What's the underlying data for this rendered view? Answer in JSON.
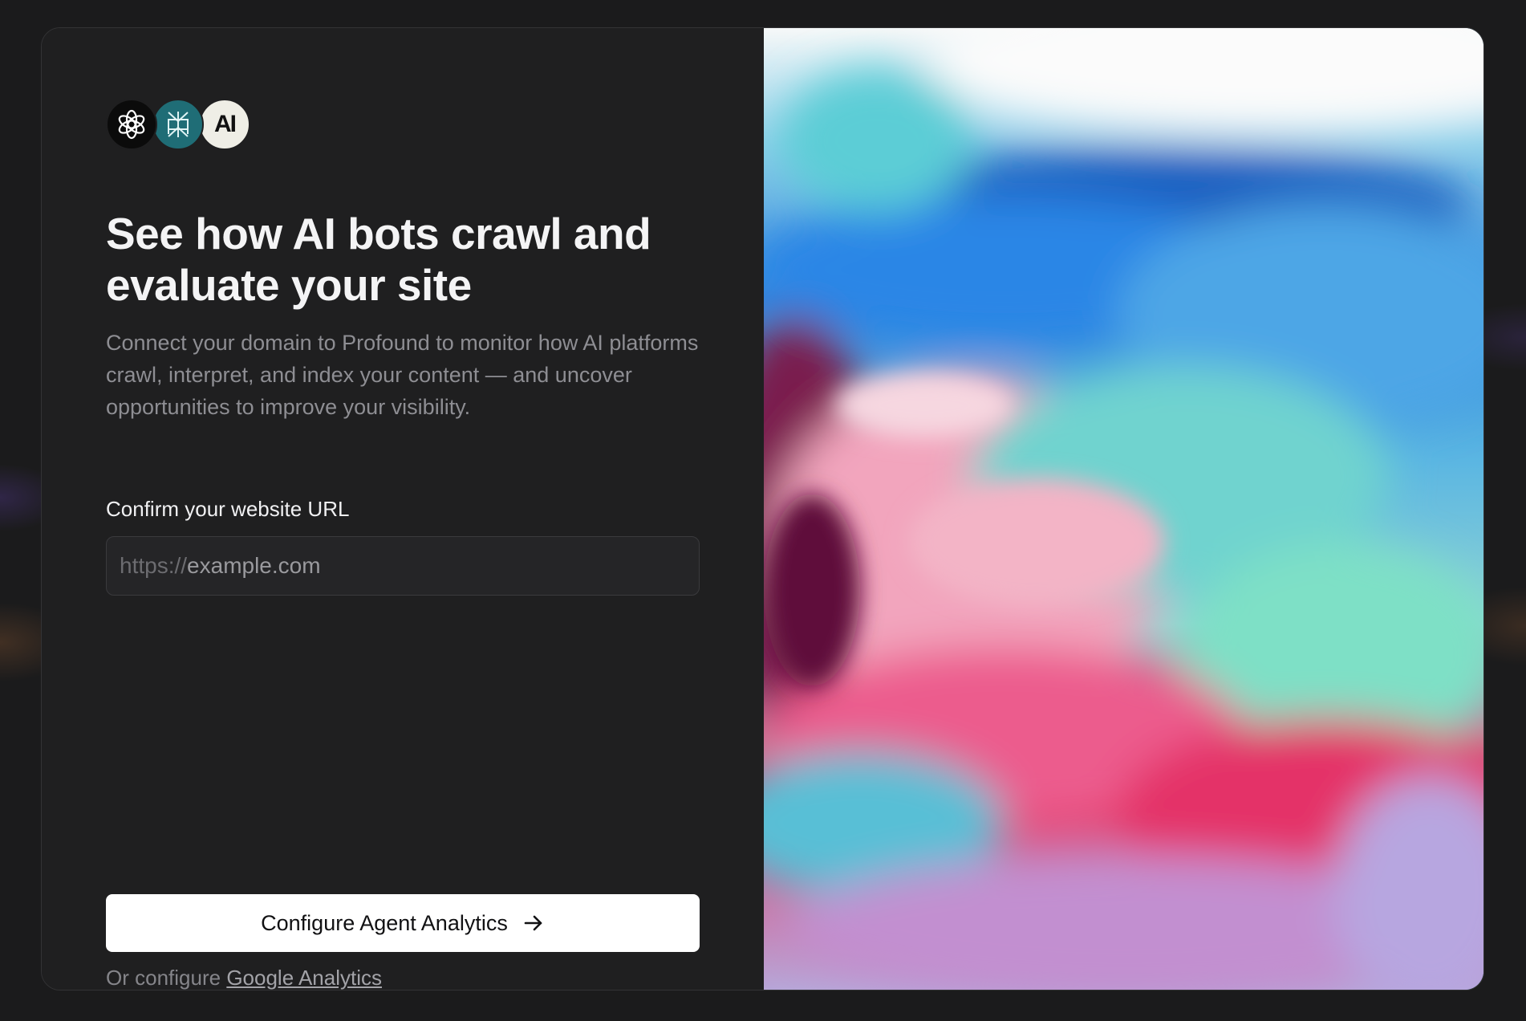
{
  "hero": {
    "title": "See how AI bots crawl and evaluate your site",
    "subtitle": "Connect your domain to Profound to monitor how AI platforms crawl, interpret, and index your content — and uncover opportunities to improve your visibility."
  },
  "logos": {
    "anthropic_text": "AI"
  },
  "form": {
    "label": "Confirm your website URL",
    "prefix": "https://",
    "placeholder": "example.com"
  },
  "actions": {
    "primary_label": "Configure Agent Analytics",
    "alt_prefix": "Or configure",
    "alt_link": "Google Analytics"
  },
  "icons": {
    "openai": "openai-logo-icon",
    "perplexity": "perplexity-logo-icon",
    "anthropic": "anthropic-logo-icon",
    "arrow": "arrow-right-icon"
  },
  "colors": {
    "background": "#1f1f20",
    "accent_button": "#ffffff",
    "perplexity_teal": "#1f6d76"
  }
}
